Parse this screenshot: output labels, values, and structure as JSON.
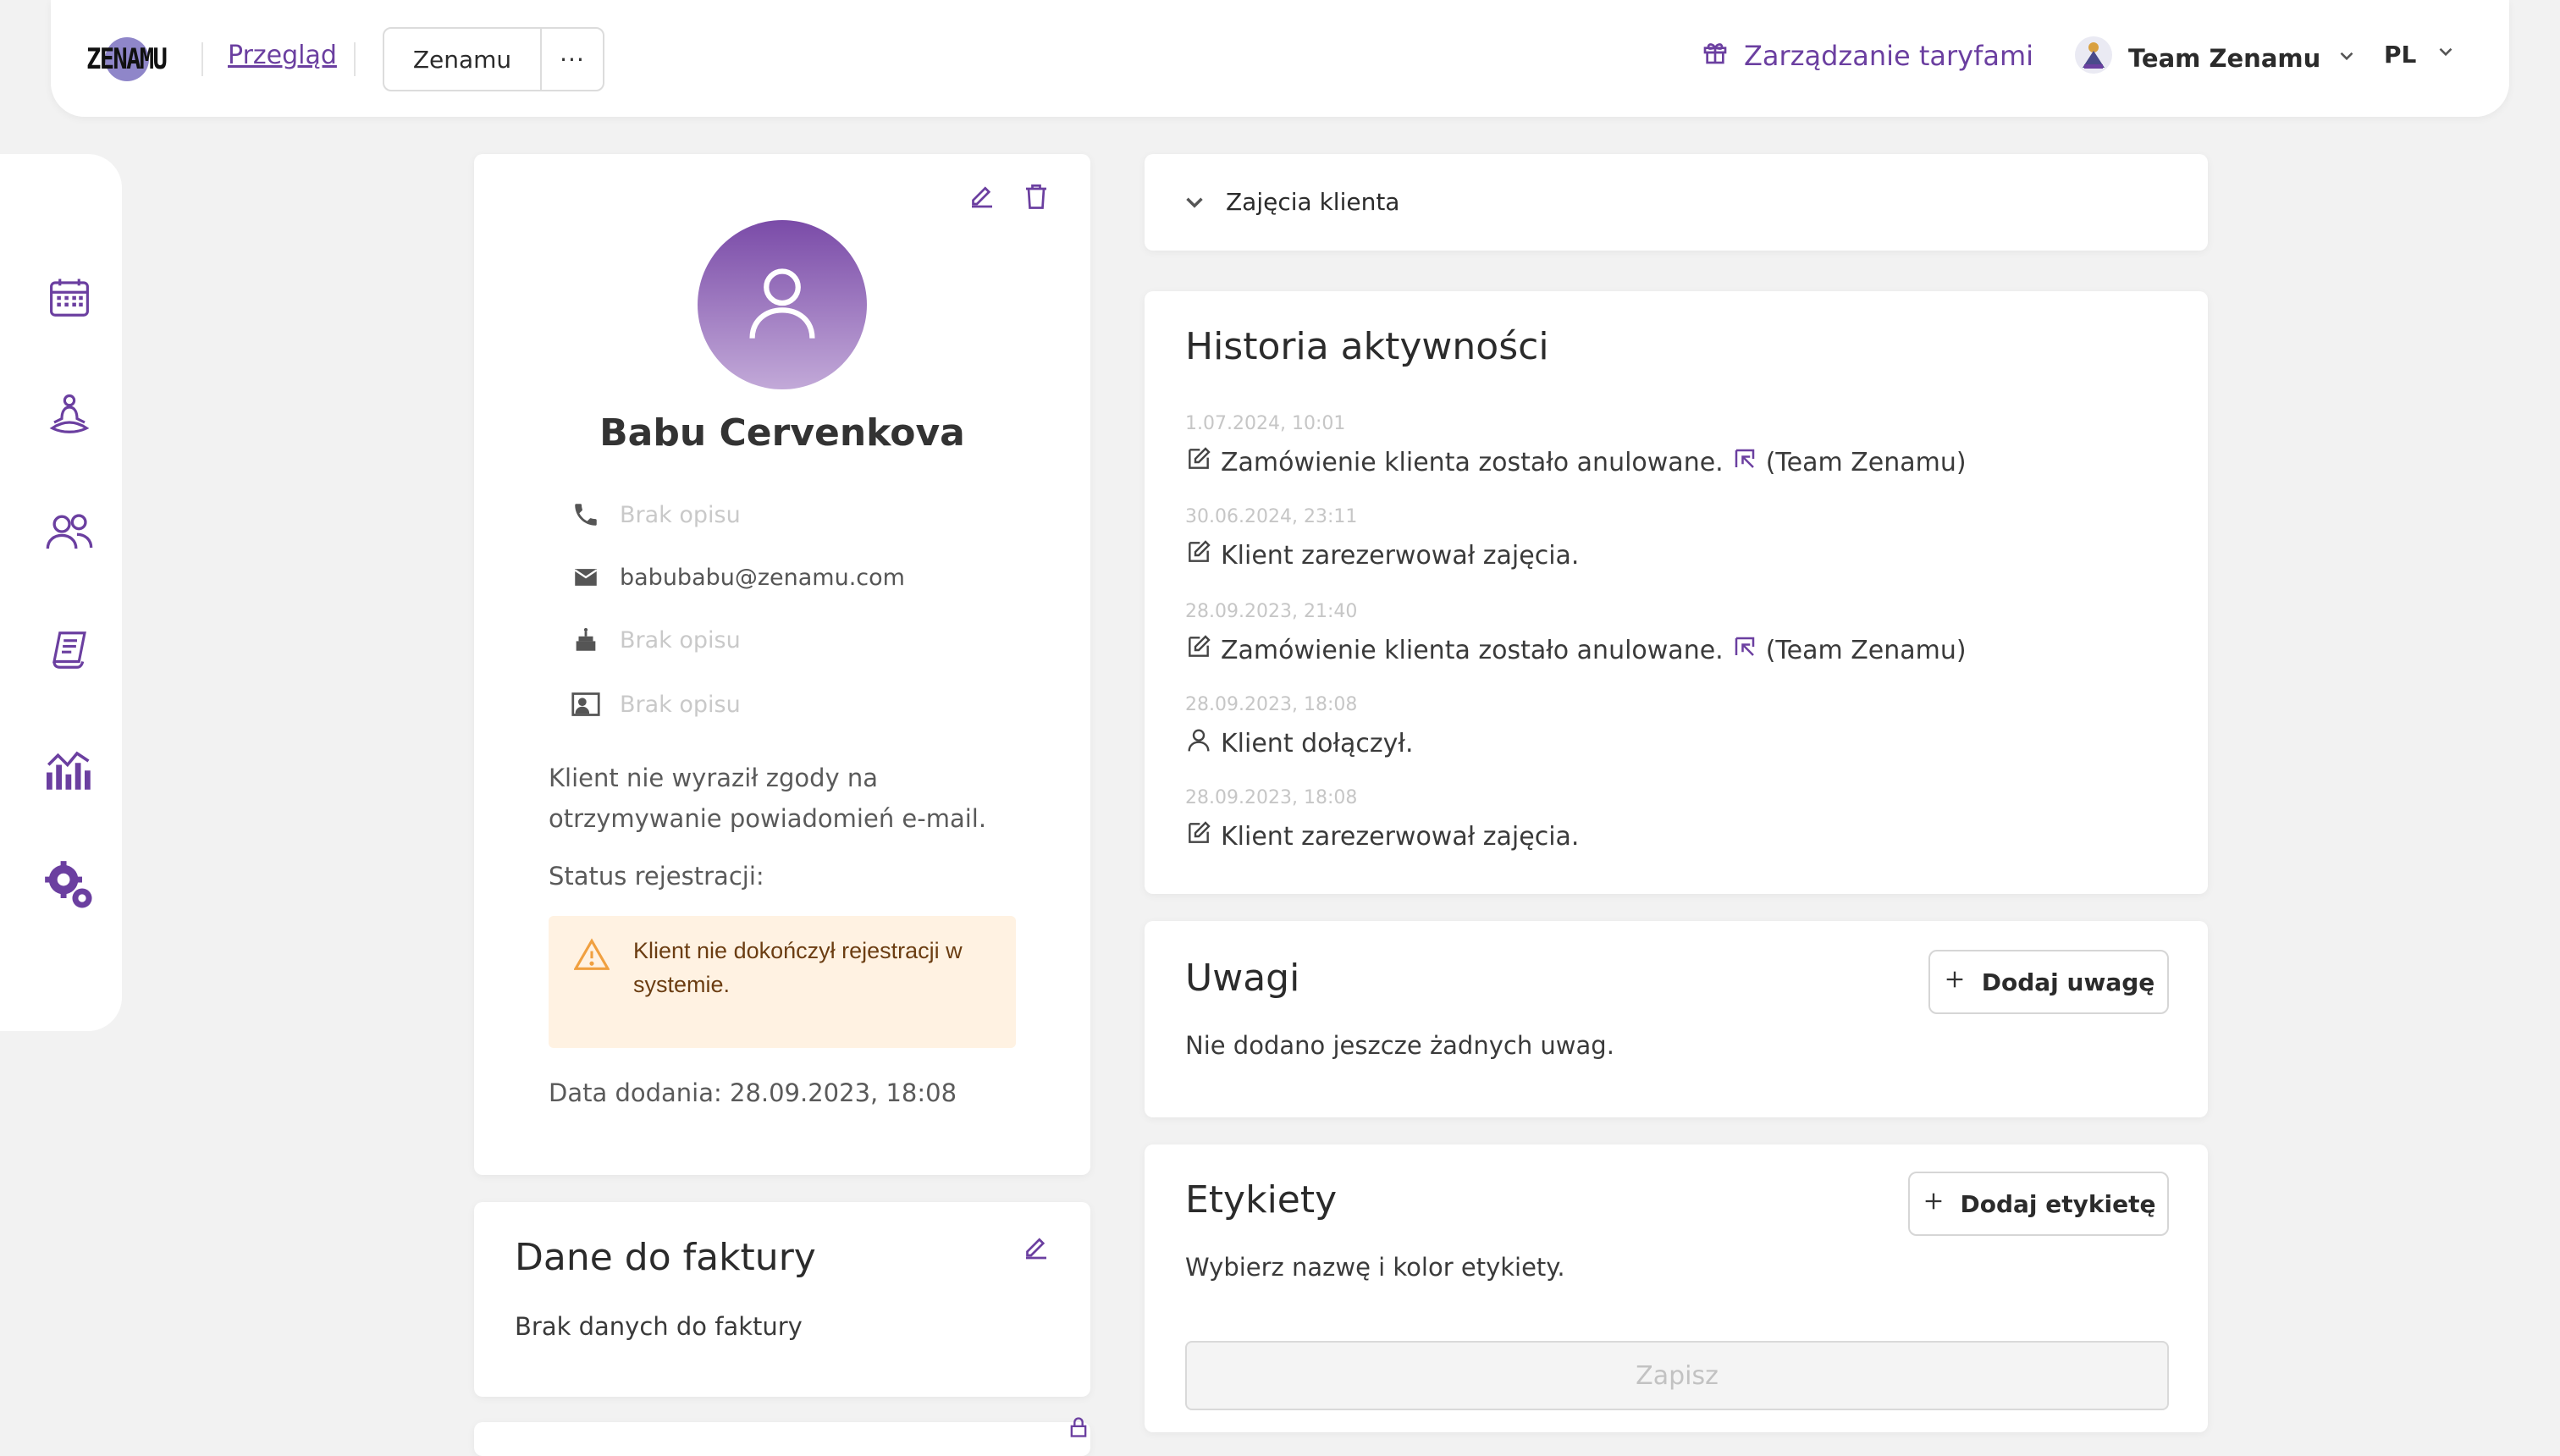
{
  "brand": {
    "logo_text": "ZENAMU"
  },
  "header": {
    "overview_link": "Przegląd",
    "studio_button": "Zenamu",
    "more_button": "···",
    "tariff_link": "Zarządzanie taryfami",
    "team_name": "Team Zenamu",
    "language": "PL"
  },
  "colors": {
    "accent": "#6b3fa0",
    "avatar_top": "#7a4ba8",
    "avatar_bottom": "#c2a9d8",
    "warning_bg": "#fff2e2",
    "warning_icon": "#f0a040"
  },
  "sidebar": {
    "items": [
      {
        "icon": "calendar-icon"
      },
      {
        "icon": "meditation-icon"
      },
      {
        "icon": "users-icon"
      },
      {
        "icon": "invoice-icon"
      },
      {
        "icon": "chart-icon"
      },
      {
        "icon": "settings-icon"
      }
    ]
  },
  "profile": {
    "name": "Babu Cervenkova",
    "phone": "Brak opisu",
    "email": "babubabu@zenamu.com",
    "birthday": "Brak opisu",
    "id_card": "Brak opisu",
    "consent_text_1": "Klient nie wyraził zgody na",
    "consent_text_2": "otrzymywanie powiadomień e-mail.",
    "registration_label": "Status rejestracji:",
    "warning_1": "Klient nie dokończył rejestracji w",
    "warning_2": "systemie.",
    "date_added": "Data dodania: 28.09.2023, 18:08"
  },
  "invoice": {
    "title": "Dane do faktury",
    "empty": "Brak danych do faktury"
  },
  "classes": {
    "label": "Zajęcia klienta"
  },
  "activity": {
    "title": "Historia aktywności",
    "items": [
      {
        "time": "1.07.2024, 10:01",
        "text": "Zamówienie klienta zostało anulowane.",
        "suffix": "(Team Zenamu)",
        "icon": "edit-icon"
      },
      {
        "time": "30.06.2024, 23:11",
        "text": "Klient zarezerwował zajęcia.",
        "suffix": "",
        "icon": "edit-icon"
      },
      {
        "time": "28.09.2023, 21:40",
        "text": "Zamówienie klienta zostało anulowane.",
        "suffix": "(Team Zenamu)",
        "icon": "edit-icon"
      },
      {
        "time": "28.09.2023, 18:08",
        "text": "Klient dołączył.",
        "suffix": "",
        "icon": "user-icon"
      },
      {
        "time": "28.09.2023, 18:08",
        "text": "Klient zarezerwował zajęcia.",
        "suffix": "",
        "icon": "edit-icon"
      }
    ]
  },
  "notes": {
    "title": "Uwagi",
    "add_button": "Dodaj uwagę",
    "empty": "Nie dodano jeszcze żadnych uwag."
  },
  "labels": {
    "title": "Etykiety",
    "add_button": "Dodaj etykietę",
    "hint": "Wybierz nazwę i kolor etykiety.",
    "save_button": "Zapisz"
  }
}
